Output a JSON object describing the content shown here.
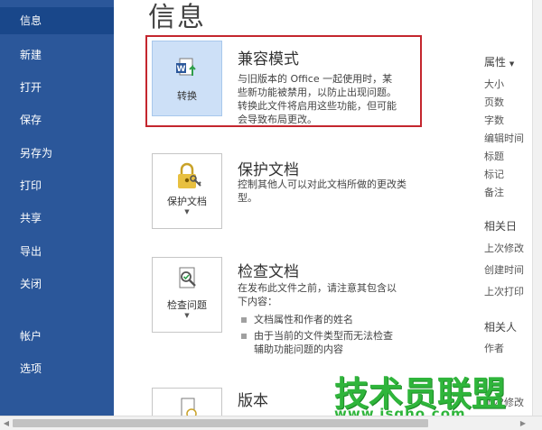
{
  "nav": {
    "items": [
      {
        "id": "info",
        "label": "信息",
        "active": true
      },
      {
        "id": "new",
        "label": "新建"
      },
      {
        "id": "open",
        "label": "打开"
      },
      {
        "id": "save",
        "label": "保存"
      },
      {
        "id": "saveas",
        "label": "另存为"
      },
      {
        "id": "print",
        "label": "打印"
      },
      {
        "id": "share",
        "label": "共享"
      },
      {
        "id": "export",
        "label": "导出"
      },
      {
        "id": "close",
        "label": "关闭"
      },
      {
        "id": "account",
        "label": "帐户"
      },
      {
        "id": "options",
        "label": "选项"
      }
    ]
  },
  "page": {
    "title": "信息"
  },
  "sections": {
    "compat": {
      "tile_label": "转换",
      "title": "兼容模式",
      "desc": "与旧版本的 Office 一起使用时，某些新功能被禁用，以防止出现问题。转换此文件将启用这些功能，但可能会导致布局更改。"
    },
    "protect": {
      "tile_label": "保护文档",
      "title": "保护文档",
      "desc": "控制其他人可以对此文档所做的更改类型。"
    },
    "inspect": {
      "tile_label": "检查问题",
      "title": "检查文档",
      "desc": "在发布此文件之前，请注意其包含以下内容：",
      "bullets": [
        "文档属性和作者的姓名",
        "由于当前的文件类型而无法检查辅助功能问题的内容"
      ]
    },
    "versions": {
      "title": "版本"
    }
  },
  "properties": {
    "header": "属性",
    "items": [
      "大小",
      "页数",
      "字数",
      "编辑时间",
      "标题",
      "标记",
      "备注"
    ],
    "dates_header": "相关日",
    "dates": [
      "上次修改",
      "创建时间",
      "上次打印"
    ],
    "people_header": "相关人",
    "people": [
      "作者"
    ],
    "last_modified_by": "上次修改"
  },
  "watermark": {
    "text": "技术员联盟",
    "url": "www.jsgho.com"
  },
  "colors": {
    "sidebar": "#2b579a",
    "sidebar_active": "#19478a",
    "highlight": "#c4262e",
    "tile_selected": "#cde0f7",
    "watermark": "#2fb53b"
  }
}
